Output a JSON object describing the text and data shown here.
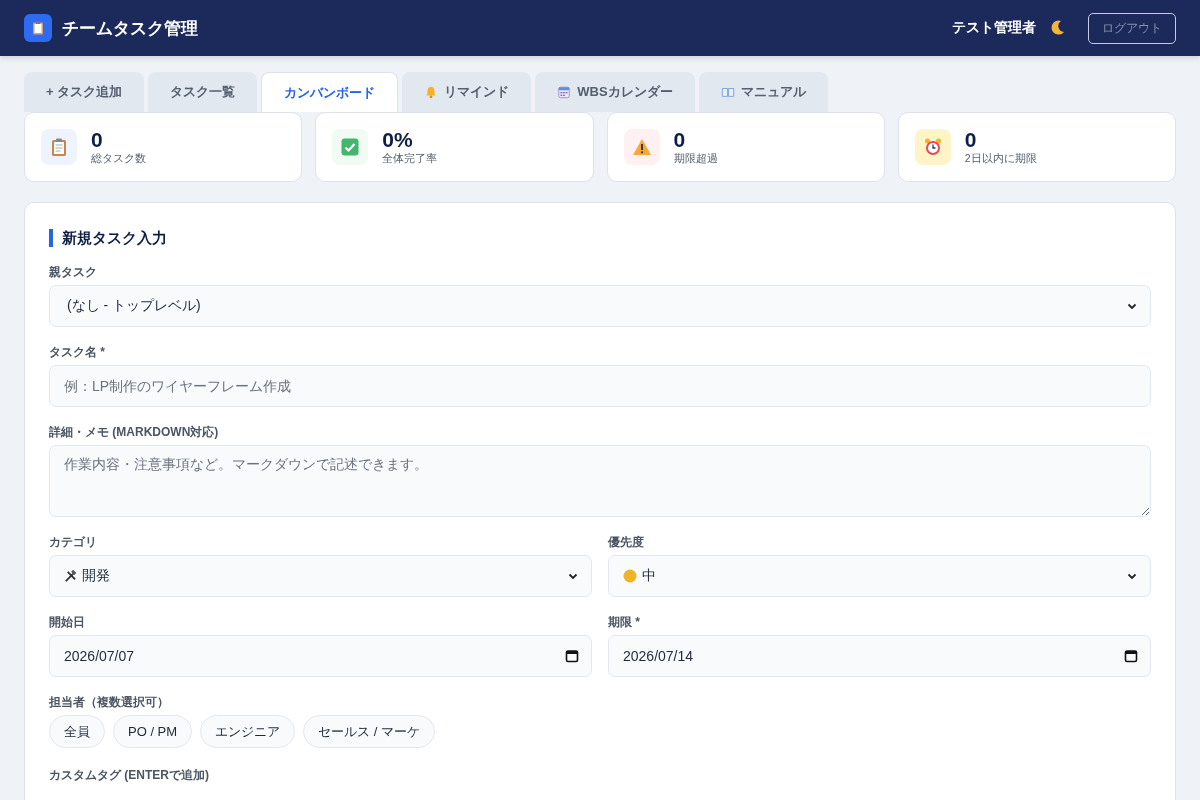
{
  "header": {
    "title": "チームタスク管理",
    "user": "テスト管理者",
    "logout": "ログアウト"
  },
  "tabs": [
    {
      "label": "+ タスク追加",
      "selected": false
    },
    {
      "label": "タスク一覧",
      "selected": false
    },
    {
      "label": "カンバンボード",
      "selected": true
    },
    {
      "label": "リマインド",
      "selected": false
    },
    {
      "label": "WBSカレンダー",
      "selected": false
    },
    {
      "label": "マニュアル",
      "selected": false
    }
  ],
  "stats": [
    {
      "value": "0",
      "label": "総タスク数"
    },
    {
      "value": "0%",
      "label": "全体完了率"
    },
    {
      "value": "0",
      "label": "期限超過"
    },
    {
      "value": "0",
      "label": "2日以内に期限"
    }
  ],
  "form": {
    "title": "新規タスク入力",
    "parent": {
      "label": "親タスク",
      "value": "(なし - トップレベル)"
    },
    "name": {
      "label": "タスク名 *",
      "placeholder": "例：LP制作のワイヤーフレーム作成"
    },
    "memo": {
      "label": "詳細・メモ (MARKDOWN対応)",
      "placeholder": "作業内容・注意事項など。マークダウンで記述できます。"
    },
    "category": {
      "label": "カテゴリ",
      "value": "開発"
    },
    "priority": {
      "label": "優先度",
      "value": "中"
    },
    "start": {
      "label": "開始日",
      "value": "2026/07/07"
    },
    "due": {
      "label": "期限 *",
      "value": "2026/07/14"
    },
    "assignees": {
      "label": "担当者（複数選択可）",
      "options": [
        {
          "label": "全員",
          "selected": false
        },
        {
          "label": "PO / PM",
          "selected": false
        },
        {
          "label": "エンジニア",
          "selected": false
        },
        {
          "label": "セールス / マーケ",
          "selected": false
        }
      ]
    },
    "tags": {
      "label": "カスタムタグ (ENTERで追加)"
    }
  }
}
